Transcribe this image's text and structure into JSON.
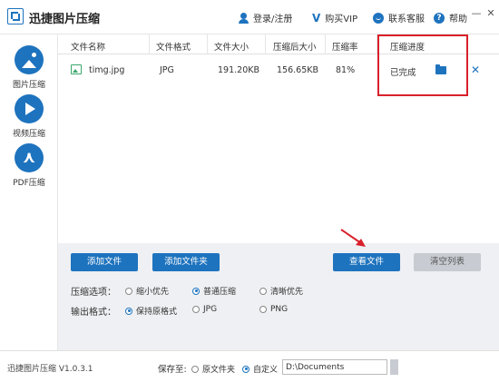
{
  "app": {
    "title": "迅捷图片压缩",
    "top_links": {
      "login": "登录/注册",
      "vip": "购买VIP",
      "service": "联系客服",
      "help": "帮助"
    },
    "window_controls": {
      "minimize": "—",
      "close": "✕"
    }
  },
  "sidebar": {
    "items": [
      {
        "label": "图片压缩",
        "icon": "image-icon"
      },
      {
        "label": "视频压缩",
        "icon": "play-icon"
      },
      {
        "label": "PDF压缩",
        "icon": "pdf-icon"
      }
    ]
  },
  "table": {
    "headers": [
      "文件名称",
      "文件格式",
      "文件大小",
      "压缩后大小",
      "压缩率",
      "压缩进度"
    ],
    "rows": [
      {
        "name": "timg.jpg",
        "format": "JPG",
        "size": "191.20KB",
        "compressed": "156.65KB",
        "ratio": "81%",
        "progress": "已完成"
      }
    ],
    "close_glyph": "✕"
  },
  "buttons": {
    "add_file": "添加文件",
    "add_folder": "添加文件夹",
    "view_file": "查看文件",
    "clear_list": "清空列表"
  },
  "options": {
    "compress_label": "压缩选项：",
    "compress_choices": [
      "缩小优先",
      "普通压缩",
      "清晰优先"
    ],
    "compress_selected": "普通压缩",
    "format_label": "输出格式：",
    "format_choices": [
      "保持原格式",
      "JPG",
      "PNG"
    ],
    "format_selected": "保持原格式"
  },
  "status": {
    "version": "迅捷图片压缩 V1.0.3.1",
    "save_to": "保存至:",
    "save_choices": [
      "原文件夹",
      "自定义"
    ],
    "save_selected": "自定义",
    "path": "D:\\Documents"
  },
  "colors": {
    "accent": "#1e73be",
    "highlight": "#d9202a",
    "panel": "#eef0f3"
  }
}
